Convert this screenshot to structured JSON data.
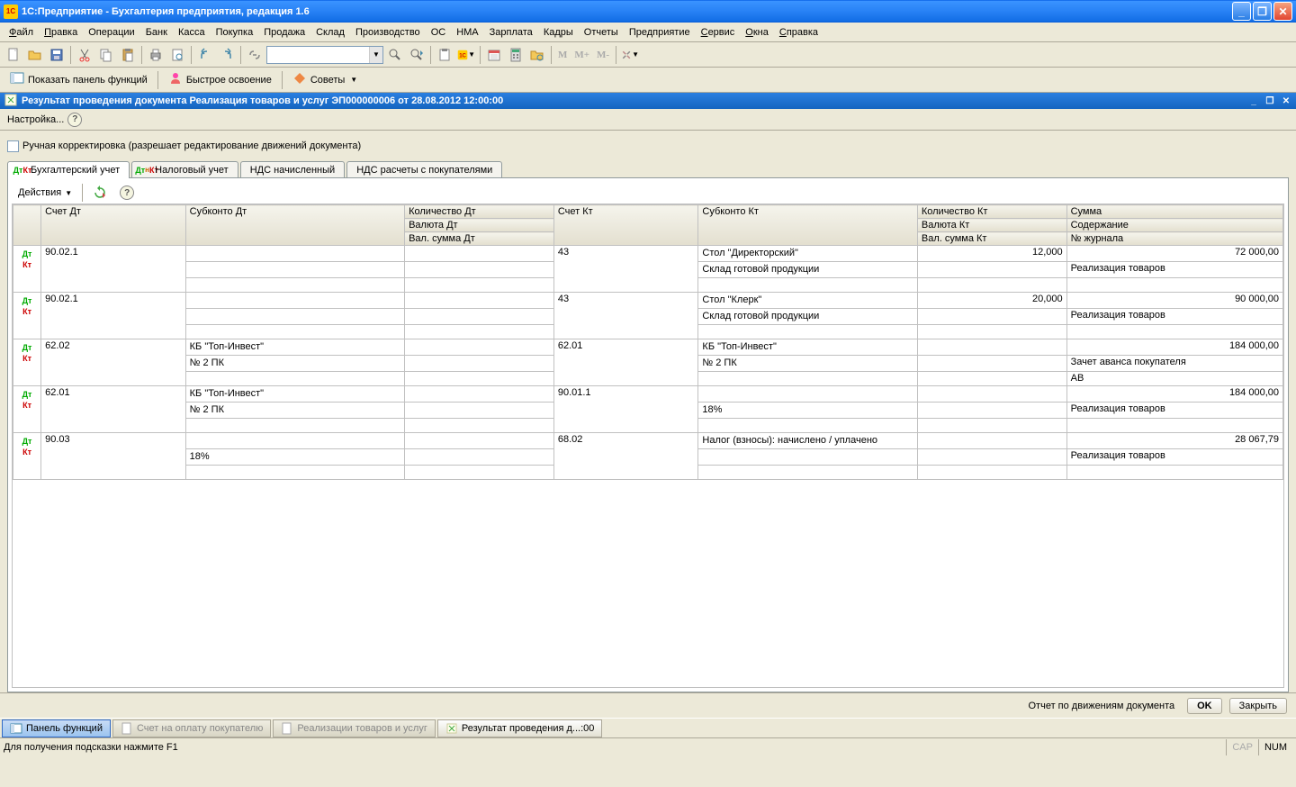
{
  "title": "1С:Предприятие - Бухгалтерия предприятия, редакция 1.6",
  "menu": [
    "Файл",
    "Правка",
    "Операции",
    "Банк",
    "Касса",
    "Покупка",
    "Продажа",
    "Склад",
    "Производство",
    "ОС",
    "НМА",
    "Зарплата",
    "Кадры",
    "Отчеты",
    "Предприятие",
    "Сервис",
    "Окна",
    "Справка"
  ],
  "menu_ul": [
    "Ф",
    "П",
    "",
    "",
    "",
    "",
    "",
    "",
    "",
    "",
    "",
    "",
    "",
    "",
    "",
    "С",
    "О",
    "С"
  ],
  "toolbar2": {
    "panel": "Показать панель функций",
    "quick": "Быстрое освоение",
    "advice": "Советы"
  },
  "subtitle": "Результат проведения документа Реализация товаров и услуг ЭП000000006 от 28.08.2012 12:00:00",
  "cfg": {
    "label": "Настройка..."
  },
  "manual": "Ручная корректировка (разрешает редактирование движений документа)",
  "tabs": [
    "Бухгалтерский учет",
    "Налоговый учет",
    "НДС начисленный",
    "НДС расчеты с покупателями"
  ],
  "actions": "Действия",
  "headers": {
    "dt": "Счет Дт",
    "subdt": "Субконто Дт",
    "qtydt": "Количество Дт",
    "valdt": "Валюта Дт",
    "vsumdt": "Вал. сумма Дт",
    "kt": "Счет Кт",
    "subkt": "Субконто Кт",
    "qtykt": "Количество Кт",
    "valkt": "Валюта Кт",
    "vsumkt": "Вал. сумма Кт",
    "sum": "Сумма",
    "cont": "Содержание",
    "jrn": "№ журнала"
  },
  "rows": [
    {
      "dt": "90.02.1",
      "subdt": [
        "",
        ""
      ],
      "kt": "43",
      "subkt": [
        "Стол \"Директорский\"",
        "Склад готовой продукции"
      ],
      "qtykt": "12,000",
      "sum": "72 000,00",
      "cont": "Реализация товаров",
      "jrn": ""
    },
    {
      "dt": "90.02.1",
      "subdt": [
        "",
        ""
      ],
      "kt": "43",
      "subkt": [
        "Стол \"Клерк\"",
        "Склад готовой продукции"
      ],
      "qtykt": "20,000",
      "sum": "90 000,00",
      "cont": "Реализация товаров",
      "jrn": ""
    },
    {
      "dt": "62.02",
      "subdt": [
        "КБ \"Топ-Инвест\"",
        "№ 2 ПК"
      ],
      "kt": "62.01",
      "subkt": [
        "КБ \"Топ-Инвест\"",
        "№ 2 ПК"
      ],
      "qtykt": "",
      "sum": "184 000,00",
      "cont": "Зачет аванса покупателя",
      "jrn": "АВ"
    },
    {
      "dt": "62.01",
      "subdt": [
        "КБ \"Топ-Инвест\"",
        "№ 2 ПК"
      ],
      "kt": "90.01.1",
      "subkt": [
        "",
        "18%"
      ],
      "qtykt": "",
      "sum": "184 000,00",
      "cont": "Реализация товаров",
      "jrn": ""
    },
    {
      "dt": "90.03",
      "subdt": [
        "",
        "18%"
      ],
      "kt": "68.02",
      "subkt": [
        "Налог (взносы): начислено / уплачено",
        ""
      ],
      "qtykt": "",
      "sum": "28 067,79",
      "cont": "Реализация товаров",
      "jrn": ""
    }
  ],
  "footer": {
    "report": "Отчет по движениям документа",
    "ok": "OK",
    "close": "Закрыть"
  },
  "taskbar": [
    "Панель функций",
    "Счет на оплату покупателю",
    "Реализации товаров и услуг",
    "Результат проведения д...:00"
  ],
  "status": {
    "hint": "Для получения подсказки нажмите F1",
    "cap": "CAP",
    "num": "NUM"
  }
}
